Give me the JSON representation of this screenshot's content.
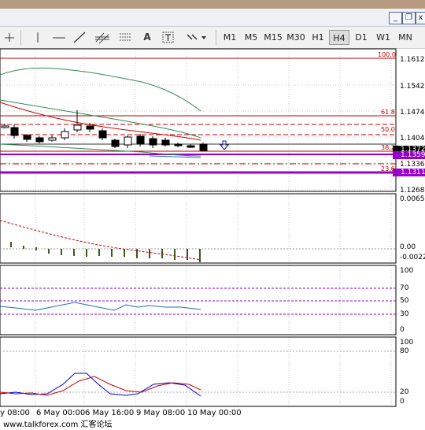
{
  "window": {
    "minimize_label": "_",
    "restore_label": "❐",
    "close_label": "x"
  },
  "toolbar": {
    "text_tool_label": "A",
    "timeframes": [
      "M1",
      "M5",
      "M15",
      "M30",
      "H1",
      "H4",
      "D1",
      "W1",
      "MN"
    ],
    "active_timeframe": "H4"
  },
  "price_axis": {
    "ticks": [
      "1.16120",
      "1.15420",
      "1.14740",
      "1.14040",
      "1.13360",
      "1.12680"
    ],
    "current_tag": "1.13726",
    "purple_tag_1": "1.13590",
    "purple_tag_2": "1.13117"
  },
  "fibonacci": {
    "levels": [
      "100.0",
      "61.8",
      "50.0",
      "38.2",
      "23.6"
    ]
  },
  "macd_axis": {
    "ticks": [
      "0.00659",
      "0.00",
      "-0.00222"
    ]
  },
  "stoch1_axis": {
    "ticks": [
      "100",
      "70",
      "50",
      "30",
      "0"
    ]
  },
  "stoch2_axis": {
    "ticks": [
      "100",
      "80",
      "20",
      "0"
    ]
  },
  "time_axis": {
    "labels": [
      "y 08:00",
      "6 May 00:00",
      "6 May 16:00",
      "9 May 08:00",
      "10 May 00:00"
    ]
  },
  "watermark": "www.talkforex.com 汇客论坛",
  "colors": {
    "fib_line": "#c00000",
    "purple_line": "#9900cc",
    "ma_green": "#2e8b57",
    "ma_red": "#cc0000",
    "stoch_blue": "#0000cc",
    "stoch_red": "#cc0000",
    "rsi_blue": "#1e6fbf"
  }
}
